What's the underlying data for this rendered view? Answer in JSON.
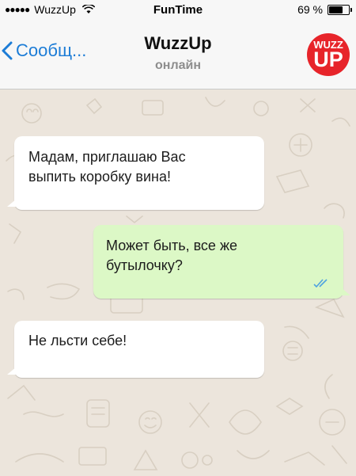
{
  "status_bar": {
    "carrier": "WuzzUp",
    "app_name": "FunTime",
    "battery_text": "69 %",
    "battery_level": 0.69
  },
  "header": {
    "back_label": "Сообщ...",
    "title": "WuzzUp",
    "subtitle": "онлайн",
    "logo_line1": "WUZZ",
    "logo_line2": "UP",
    "logo_color": "#e7242a"
  },
  "messages": [
    {
      "direction": "incoming",
      "lines": [
        "Мадам, приглашаю Вас",
        "выпить коробку вина!"
      ]
    },
    {
      "direction": "outgoing",
      "lines": [
        "Может быть, все же",
        "бутылочку?"
      ],
      "status": "read"
    },
    {
      "direction": "incoming",
      "lines": [
        "Не льсти себе!"
      ]
    }
  ],
  "colors": {
    "accent": "#1c7cd6",
    "chat_background": "#ece5dc",
    "outgoing_bubble": "#dcf8c6",
    "incoming_bubble": "#ffffff",
    "read_ticks": "#4fa3e0"
  }
}
